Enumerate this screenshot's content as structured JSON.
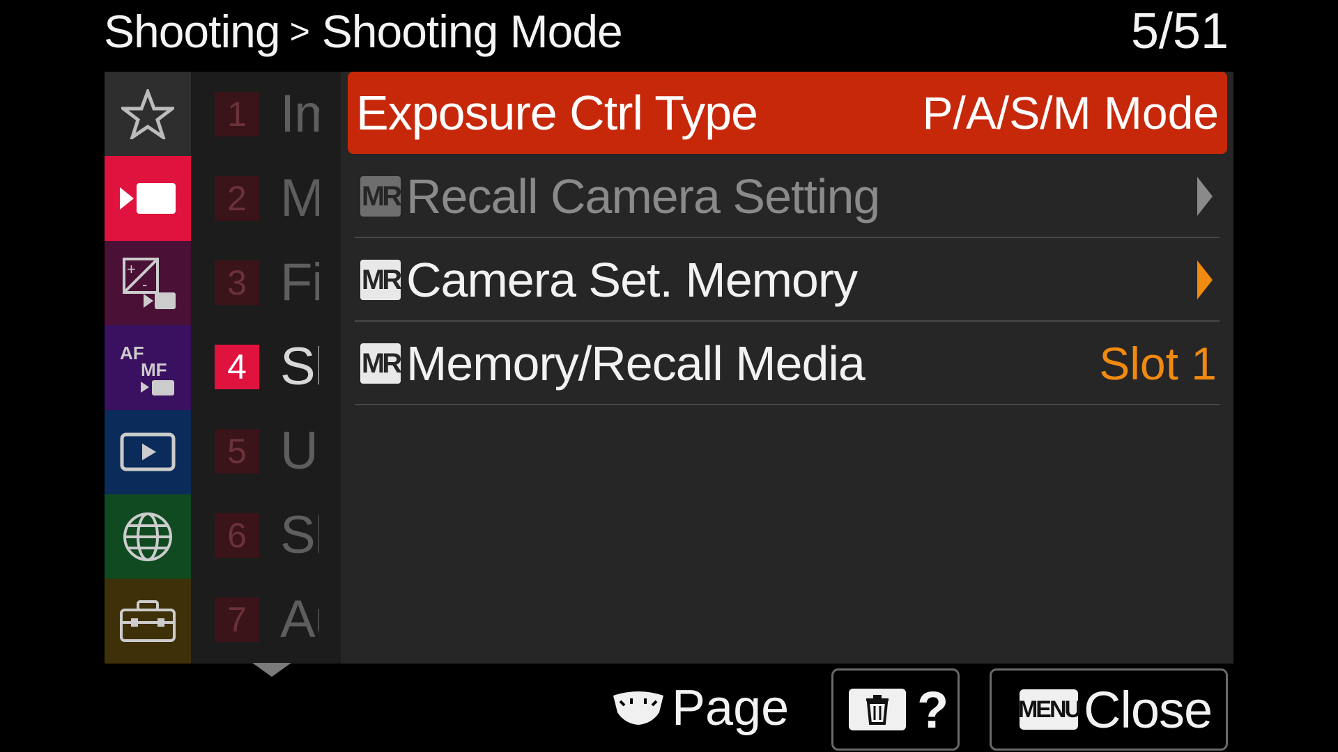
{
  "header": {
    "breadcrumb_root": "Shooting",
    "breadcrumb_separator": ">",
    "breadcrumb_current": "Shooting Mode",
    "page_counter": "5/51"
  },
  "categories": [
    {
      "icon": "star-icon",
      "color": "#2e2e2e",
      "active": false
    },
    {
      "icon": "movie-camera-icon",
      "color": "#e0123e",
      "active": true
    },
    {
      "icon": "exposure-color-icon",
      "color": "#4a1036",
      "active": false
    },
    {
      "icon": "af-mf-icon",
      "color": "#3a1060",
      "active": false,
      "text_top": "AF",
      "text_bottom": "MF"
    },
    {
      "icon": "playback-icon",
      "color": "#0b2c5a",
      "active": false
    },
    {
      "icon": "network-globe-icon",
      "color": "#0f4a20",
      "active": false
    },
    {
      "icon": "toolbox-icon",
      "color": "#3e3008",
      "active": false
    }
  ],
  "subtabs": [
    {
      "num": "1",
      "name": "Im",
      "active": false
    },
    {
      "num": "2",
      "name": "M",
      "active": false
    },
    {
      "num": "3",
      "name": "Fi",
      "active": false
    },
    {
      "num": "4",
      "name": "Sh",
      "active": true
    },
    {
      "num": "5",
      "name": "Us",
      "active": false
    },
    {
      "num": "6",
      "name": "Sh",
      "active": false
    },
    {
      "num": "7",
      "name": "Au",
      "active": false
    }
  ],
  "menu_items": [
    {
      "label": "Exposure Ctrl Type",
      "value": "P/A/S/M Mode",
      "selected": true,
      "enabled": true,
      "badge": null
    },
    {
      "label": "Recall Camera Setting",
      "value": "",
      "selected": false,
      "enabled": false,
      "badge": "MR",
      "has_arrow": true
    },
    {
      "label": "Camera Set. Memory",
      "value": "",
      "selected": false,
      "enabled": true,
      "badge": "MR",
      "has_arrow": true
    },
    {
      "label": "Memory/Recall Media",
      "value": "Slot 1",
      "selected": false,
      "enabled": true,
      "badge": "MR",
      "has_arrow": false
    }
  ],
  "colors": {
    "selected_row": "#c7280a",
    "accent_orange": "#f08a10",
    "active_tab": "#e0123e",
    "dim_text": "#8a8a8a"
  },
  "footer": {
    "page_label": "Page",
    "help_label": "?",
    "menu_badge": "MENU",
    "close_label": "Close",
    "trash_icon": "trash-icon",
    "dial_icon": "control-wheel-icon"
  }
}
